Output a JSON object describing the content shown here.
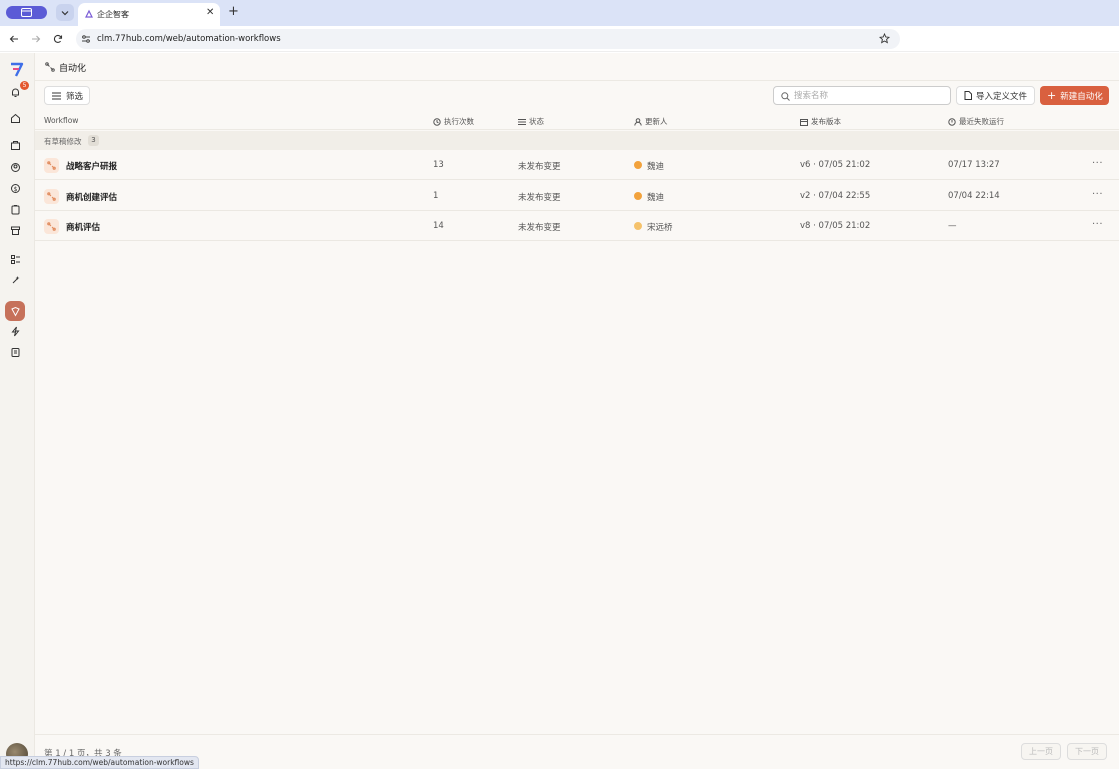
{
  "browser": {
    "tab_title": "企企智客",
    "url": "clm.77hub.com/web/automation-workflows",
    "status_url": "https://clm.77hub.com/web/automation-workflows"
  },
  "rail": {
    "notification_count": "5"
  },
  "page": {
    "title": "自动化"
  },
  "toolbar": {
    "filter_label": "筛选",
    "search_placeholder": "搜索名称",
    "import_label": "导入定义文件",
    "new_label": "新建自动化"
  },
  "table": {
    "columns": {
      "workflow": "Workflow",
      "runs": "执行次数",
      "status": "状态",
      "updated_by": "更新人",
      "version": "发布版本",
      "last_failed": "最近失败运行"
    },
    "group": {
      "label": "有草稿修改",
      "count": "3"
    },
    "rows": [
      {
        "name": "战略客户研报",
        "runs": "13",
        "status": "未发布变更",
        "updated_by": "魏迪",
        "version": "v6 · 07/05 21:02",
        "last_failed": "07/17 13:27",
        "more": "···"
      },
      {
        "name": "商机创建评估",
        "runs": "1",
        "status": "未发布变更",
        "updated_by": "魏迪",
        "version": "v2 · 07/04 22:55",
        "last_failed": "07/04 22:14",
        "more": "···"
      },
      {
        "name": "商机评估",
        "runs": "14",
        "status": "未发布变更",
        "updated_by": "宋远桥",
        "version": "v8 · 07/05 21:02",
        "last_failed": "—",
        "more": "···"
      }
    ]
  },
  "footer": {
    "page_info": "第 1 / 1 页，共 3 条",
    "prev_label": "上一页",
    "next_label": "下一页"
  },
  "colors": {
    "accent": "#d9603f",
    "rail_active": "#c6715a",
    "avatar_weidi": "#f2a23c",
    "avatar_song": "#f5c26b"
  }
}
